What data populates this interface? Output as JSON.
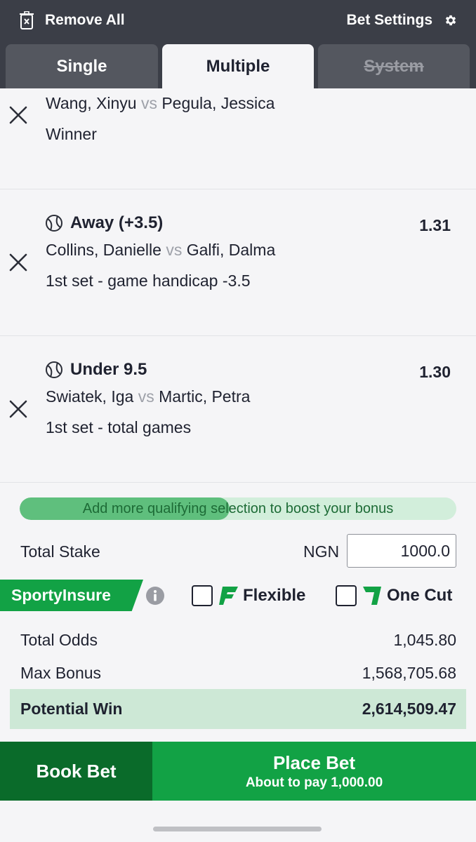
{
  "header": {
    "remove_all": "Remove All",
    "bet_settings": "Bet Settings",
    "icons": {
      "remove": "trash-icon",
      "settings": "gear-icon"
    }
  },
  "tabs": [
    {
      "label": "Single",
      "state": "inactive"
    },
    {
      "label": "Multiple",
      "state": "active"
    },
    {
      "label": "System",
      "state": "disabled"
    }
  ],
  "selections": [
    {
      "pick": "",
      "odds": "",
      "home": "Wang, Xinyu",
      "vs": "vs",
      "away": "Pegula, Jessica",
      "market": "Winner"
    },
    {
      "pick": "Away (+3.5)",
      "odds": "1.31",
      "home": "Collins, Danielle",
      "vs": "vs",
      "away": "Galfi, Dalma",
      "market": "1st set - game handicap -3.5"
    },
    {
      "pick": "Under 9.5",
      "odds": "1.30",
      "home": "Swiatek, Iga",
      "vs": "vs",
      "away": "Martic, Petra",
      "market": "1st set - total games"
    }
  ],
  "bonus": {
    "message": "Add more qualifying selection to boost your bonus",
    "progress_fraction": 0.48
  },
  "stake": {
    "label": "Total Stake",
    "currency": "NGN",
    "value": "1000.0"
  },
  "insure": {
    "label": "SportyInsure",
    "flexible_label": "Flexible",
    "one_cut_label": "One Cut",
    "flexible_checked": false,
    "one_cut_checked": false
  },
  "totals": {
    "total_odds_label": "Total Odds",
    "total_odds": "1,045.80",
    "max_bonus_label": "Max Bonus",
    "max_bonus": "1,568,705.68",
    "potential_win_label": "Potential Win",
    "potential_win": "2,614,509.47"
  },
  "actions": {
    "book_bet": "Book Bet",
    "place_bet": "Place Bet",
    "place_bet_sub": "About to pay 1,000.00"
  },
  "colors": {
    "header_bg": "#3b3e47",
    "brand_green": "#12a245",
    "dark_green": "#0a6b2a",
    "highlight_row": "#cde8d6"
  }
}
